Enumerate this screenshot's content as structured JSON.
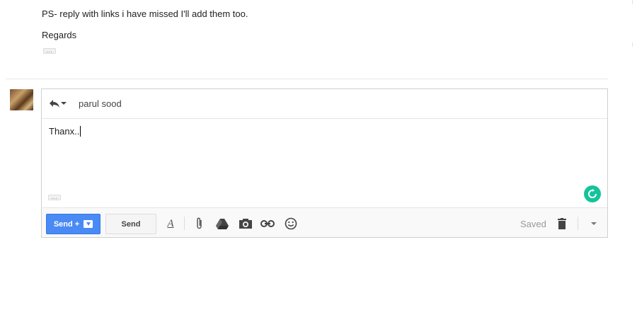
{
  "quoted_message": {
    "ps_line": "PS- reply with links i have missed I'll add them too.",
    "closing": "Regards",
    "ellipsis": "..."
  },
  "compose": {
    "recipient": "parul sood",
    "body": "Thanx..",
    "trimmed_ellipsis": "...",
    "toolbar": {
      "send_and_archive_label": "Send +",
      "send_label": "Send",
      "format_label": "A",
      "status": "Saved"
    }
  },
  "colors": {
    "send_button_blue": "#4a8af4",
    "grammar_refresh_green": "#15c39a",
    "border": "#cfcfcf"
  },
  "icons": [
    "reply-icon",
    "chevron-down-icon",
    "format-text-icon",
    "attachment-icon",
    "google-drive-icon",
    "camera-icon",
    "link-icon",
    "emoji-icon",
    "trash-icon",
    "refresh-icon",
    "archive-icon"
  ]
}
